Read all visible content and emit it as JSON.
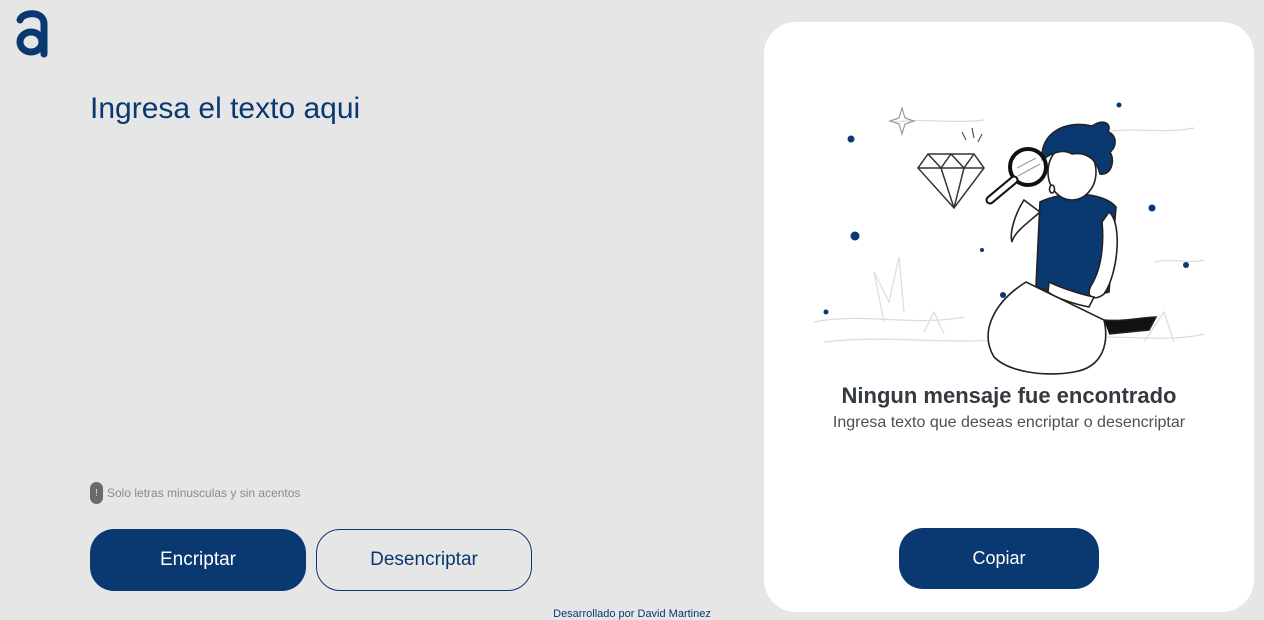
{
  "app": {
    "logo_icon": "letter-a-logo-icon",
    "accent_color": "#0a3871"
  },
  "editor": {
    "placeholder": "Ingresa el texto aqui",
    "value": "",
    "hint_icon": "exclamation-icon",
    "hint_text": "Solo letras minusculas y sin acentos"
  },
  "actions": {
    "encrypt_label": "Encriptar",
    "decrypt_label": "Desencriptar"
  },
  "output": {
    "illustration_icon": "person-with-magnifier-illustration",
    "title": "Ningun mensaje fue encontrado",
    "subtitle": "Ingresa texto que deseas encriptar o desencriptar",
    "copy_label": "Copiar"
  },
  "footer": {
    "credit": "Desarrollado por David Martinez"
  }
}
